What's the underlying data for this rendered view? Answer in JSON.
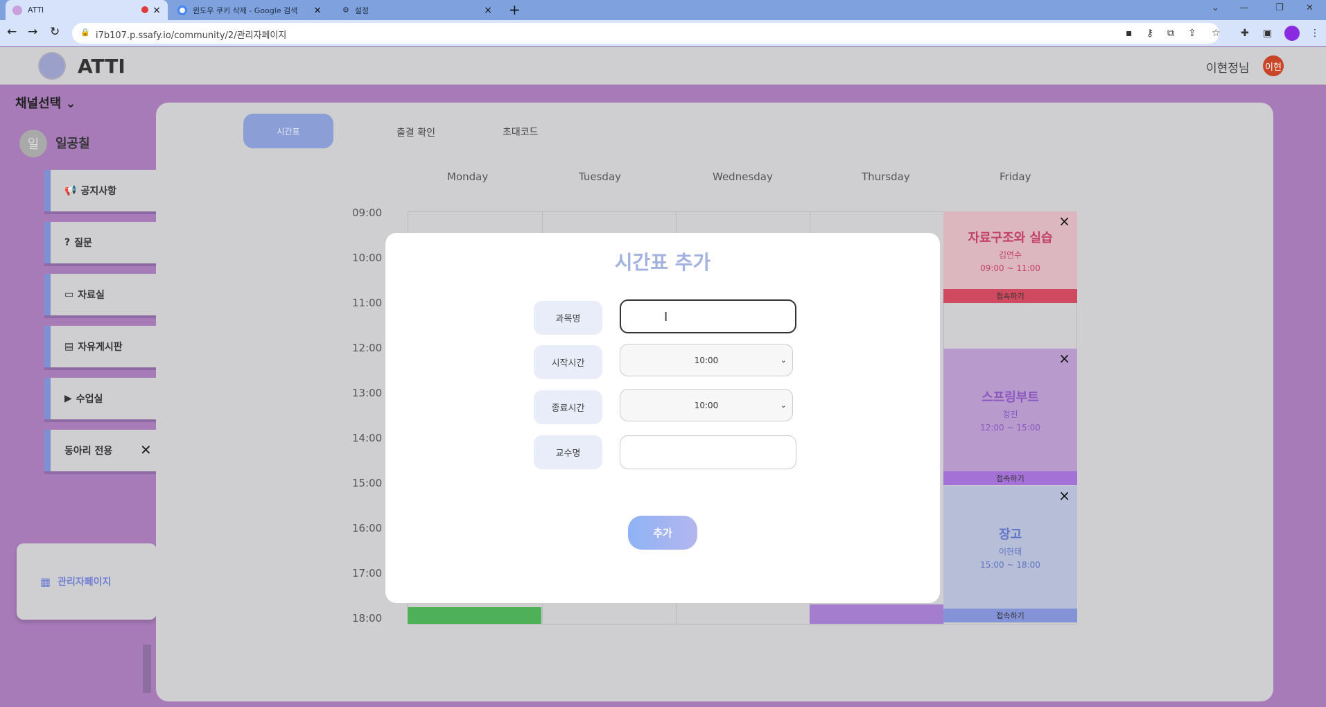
{
  "browser": {
    "tabs": [
      {
        "title": "ATTI"
      },
      {
        "title": "윈도우 쿠키 삭제 - Google 검색"
      },
      {
        "title": "설정"
      }
    ],
    "url": "i7b107.p.ssafy.io/community/2/관리자페이지",
    "new_tab": "+",
    "close_glyph": "×"
  },
  "app": {
    "title": "ATTI",
    "user_name": "이현정님",
    "user_avatar": "이현"
  },
  "sidebar": {
    "channel_select": "채널선택",
    "channel_avatar": "일",
    "channel_name": "일공칠",
    "items": [
      {
        "label": "공지사항",
        "icon": "megaphone-icon"
      },
      {
        "label": "질문",
        "icon": "question-icon"
      },
      {
        "label": "자료실",
        "icon": "folder-icon"
      },
      {
        "label": "자유게시판",
        "icon": "board-icon"
      },
      {
        "label": "수업실",
        "icon": "video-icon"
      },
      {
        "label": "동아리 전용",
        "icon": ""
      }
    ],
    "admin_label": "관리자페이지"
  },
  "main": {
    "tabs": {
      "timetable": "시간표",
      "attendance": "출결 확인",
      "invite": "초대코드"
    },
    "days": [
      "Monday",
      "Tuesday",
      "Wednesday",
      "Thursday",
      "Friday"
    ],
    "times": [
      "09:00",
      "10:00",
      "11:00",
      "12:00",
      "13:00",
      "14:00",
      "15:00",
      "16:00",
      "17:00",
      "18:00"
    ],
    "events": [
      {
        "title": "자료구조와 실습",
        "professor": "김연수",
        "time": "09:00 ~ 11:00",
        "action": "접속하기",
        "color": "#dcb7c0",
        "bar": "#cf4a5e",
        "text": "#c24068"
      },
      {
        "title": "스프링부트",
        "professor": "정진",
        "time": "12:00 ~ 15:00",
        "action": "접속하기",
        "color": "#b99acd",
        "bar": "#a472d7",
        "text": "#8b58c0"
      },
      {
        "title": "장고",
        "professor": "이현태",
        "time": "15:00 ~ 18:00",
        "action": "접속하기",
        "color": "#b6bfd7",
        "bar": "#8493d8",
        "text": "#6173c4"
      }
    ]
  },
  "modal": {
    "title": "시간표 추가",
    "fields": {
      "subject": {
        "label": "과목명",
        "value": ""
      },
      "start": {
        "label": "시작시간",
        "value": "10:00"
      },
      "end": {
        "label": "종료시간",
        "value": "10:00"
      },
      "professor": {
        "label": "교수명",
        "value": ""
      }
    },
    "submit": "추가"
  }
}
